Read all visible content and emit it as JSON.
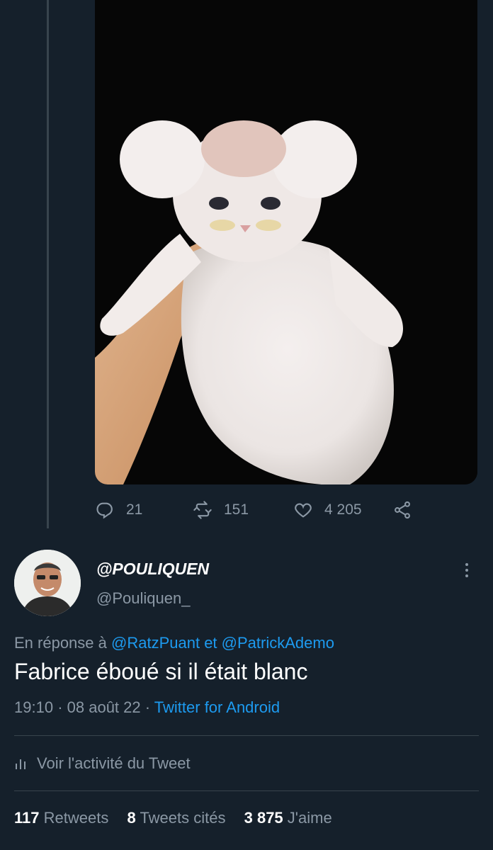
{
  "actions": {
    "reply_count": "21",
    "retweet_count": "151",
    "like_count": "4 205"
  },
  "tweet": {
    "display_name": "@POULIQUEN",
    "handle": "@Pouliquen_",
    "reply_prefix": "En réponse à",
    "reply_mention_1": "@RatzPuant",
    "reply_connector": "et",
    "reply_mention_2": "@PatrickAdemo",
    "text": "Fabrice éboué si il était blanc",
    "time": "19:10",
    "separator": "·",
    "date": "08 août 22",
    "source": "Twitter for Android",
    "activity_label": "Voir l'activité du Tweet"
  },
  "stats": {
    "retweets_count": "117",
    "retweets_label": "Retweets",
    "quotes_count": "8",
    "quotes_label": "Tweets cités",
    "likes_count": "3 875",
    "likes_label": "J'aime"
  },
  "icons": {
    "reply": "reply-icon",
    "retweet": "retweet-icon",
    "like": "heart-icon",
    "share": "share-icon",
    "more": "more-icon",
    "activity": "bar-chart-icon"
  },
  "colors": {
    "background": "#15202b",
    "accent": "#1d9bf0",
    "secondary_text": "#8b98a5",
    "divider": "#38444d"
  }
}
